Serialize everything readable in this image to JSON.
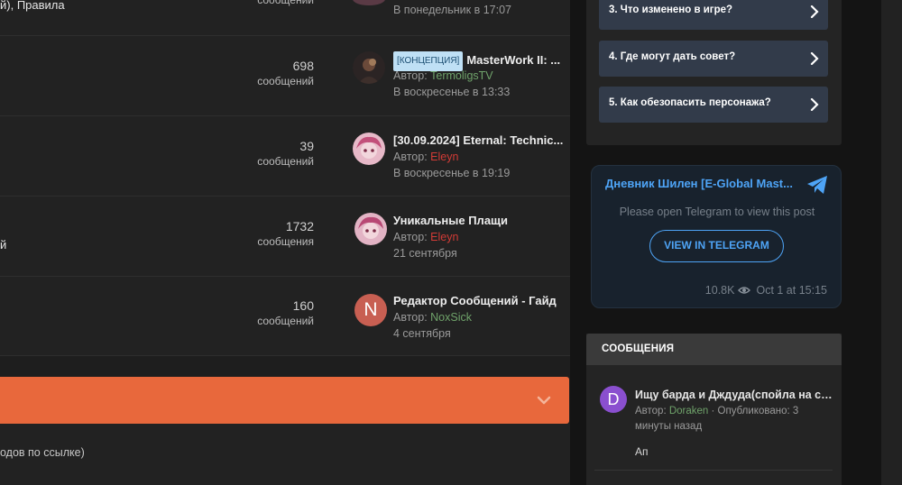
{
  "forum": {
    "rows": [
      {
        "left_text": "й),  Правила",
        "count": "",
        "count_label": "сообщений",
        "title": "",
        "author_label": "",
        "author": "",
        "date": "В понедельник в 17:07"
      },
      {
        "left_text": "",
        "count": "698",
        "count_label": "сообщений",
        "prefix": "[КОНЦЕПЦИЯ]",
        "title": "MasterWork II: ...",
        "author_label": "Автор:",
        "author": "TermoligsTV",
        "date": "В воскресенье в 13:33"
      },
      {
        "left_text": "",
        "count": "39",
        "count_label": "сообщений",
        "title": "[30.09.2024] Eternal: Technic...",
        "author_label": "Автор:",
        "author": "Eleyn",
        "date": "В воскресенье в 19:19"
      },
      {
        "left_text": "й",
        "count": "1732",
        "count_label": "сообщения",
        "title": "Уникальные Плащи",
        "author_label": "Автор:",
        "author": "Eleyn",
        "date": "21 сентября"
      },
      {
        "left_text": "",
        "count": "160",
        "count_label": "сообщений",
        "title": "Редактор Сообщений - Гайд",
        "author_label": "Автор:",
        "author": "NoxSick",
        "date": "4 сентября",
        "avatar_letter": "N"
      }
    ],
    "bottom_text": "одов по ссылке)",
    "colors": {
      "orange": "#e8683c",
      "green_user": "#6fa26a",
      "red_user": "#d23b36"
    }
  },
  "sidebar": {
    "faq": [
      "3. Что изменено в игре?",
      "4. Где могут дать совет?",
      "5. Как обезопасить персонажа?"
    ],
    "telegram": {
      "title": "Дневник Шилен [E-Global Mast...",
      "message": "Please open Telegram to view this post",
      "button": "VIEW IN TELEGRAM",
      "views": "10.8K",
      "date": "Oct 1 at 15:15"
    },
    "messages": {
      "header": "СООБЩЕНИЯ",
      "item": {
        "avatar_letter": "D",
        "title": "Ищу барда и Дждуда(спойла на старте) ...",
        "author_label": "Автор:",
        "author": "Doraken",
        "published": "· Опубликовано: 3 минуты назад",
        "snippet": "Ап"
      }
    }
  }
}
